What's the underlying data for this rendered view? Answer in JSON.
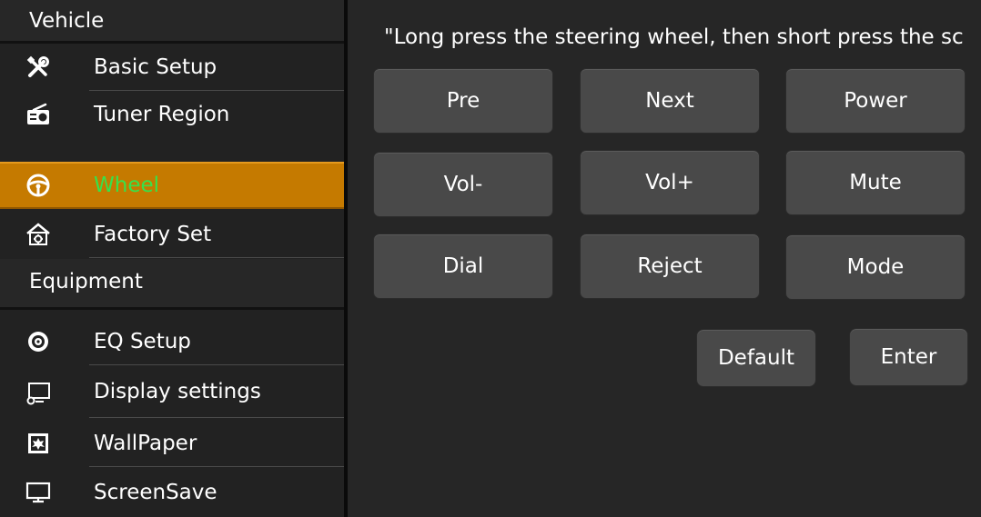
{
  "sidebar": {
    "vehicle_header": "Vehicle",
    "vehicle_items": [
      {
        "label": "Basic Setup",
        "icon": "tools-icon"
      },
      {
        "label": "Tuner Region",
        "icon": "radio-icon"
      },
      {
        "label": "Wheel",
        "icon": "steering-wheel-icon",
        "active": true
      },
      {
        "label": "Factory Set",
        "icon": "factory-gear-icon"
      }
    ],
    "equipment_header": "Equipment",
    "equipment_items": [
      {
        "label": "EQ Setup",
        "icon": "speaker-icon"
      },
      {
        "label": "Display settings",
        "icon": "monitor-gear-icon"
      },
      {
        "label": "WallPaper",
        "icon": "wallpaper-icon"
      },
      {
        "label": "ScreenSave",
        "icon": "monitor-icon"
      }
    ]
  },
  "main": {
    "hint": "\"Long press the steering wheel, then short press the sc",
    "keys": [
      "Pre",
      "Next",
      "Power",
      "Vol-",
      "Vol+",
      "Mute",
      "Dial",
      "Reject",
      "Mode"
    ],
    "default_label": "Default",
    "enter_label": "Enter"
  },
  "colors": {
    "active_bg": "#c57a00",
    "active_text": "#36e24a",
    "button_bg": "#494949",
    "panel_bg": "#262626"
  }
}
